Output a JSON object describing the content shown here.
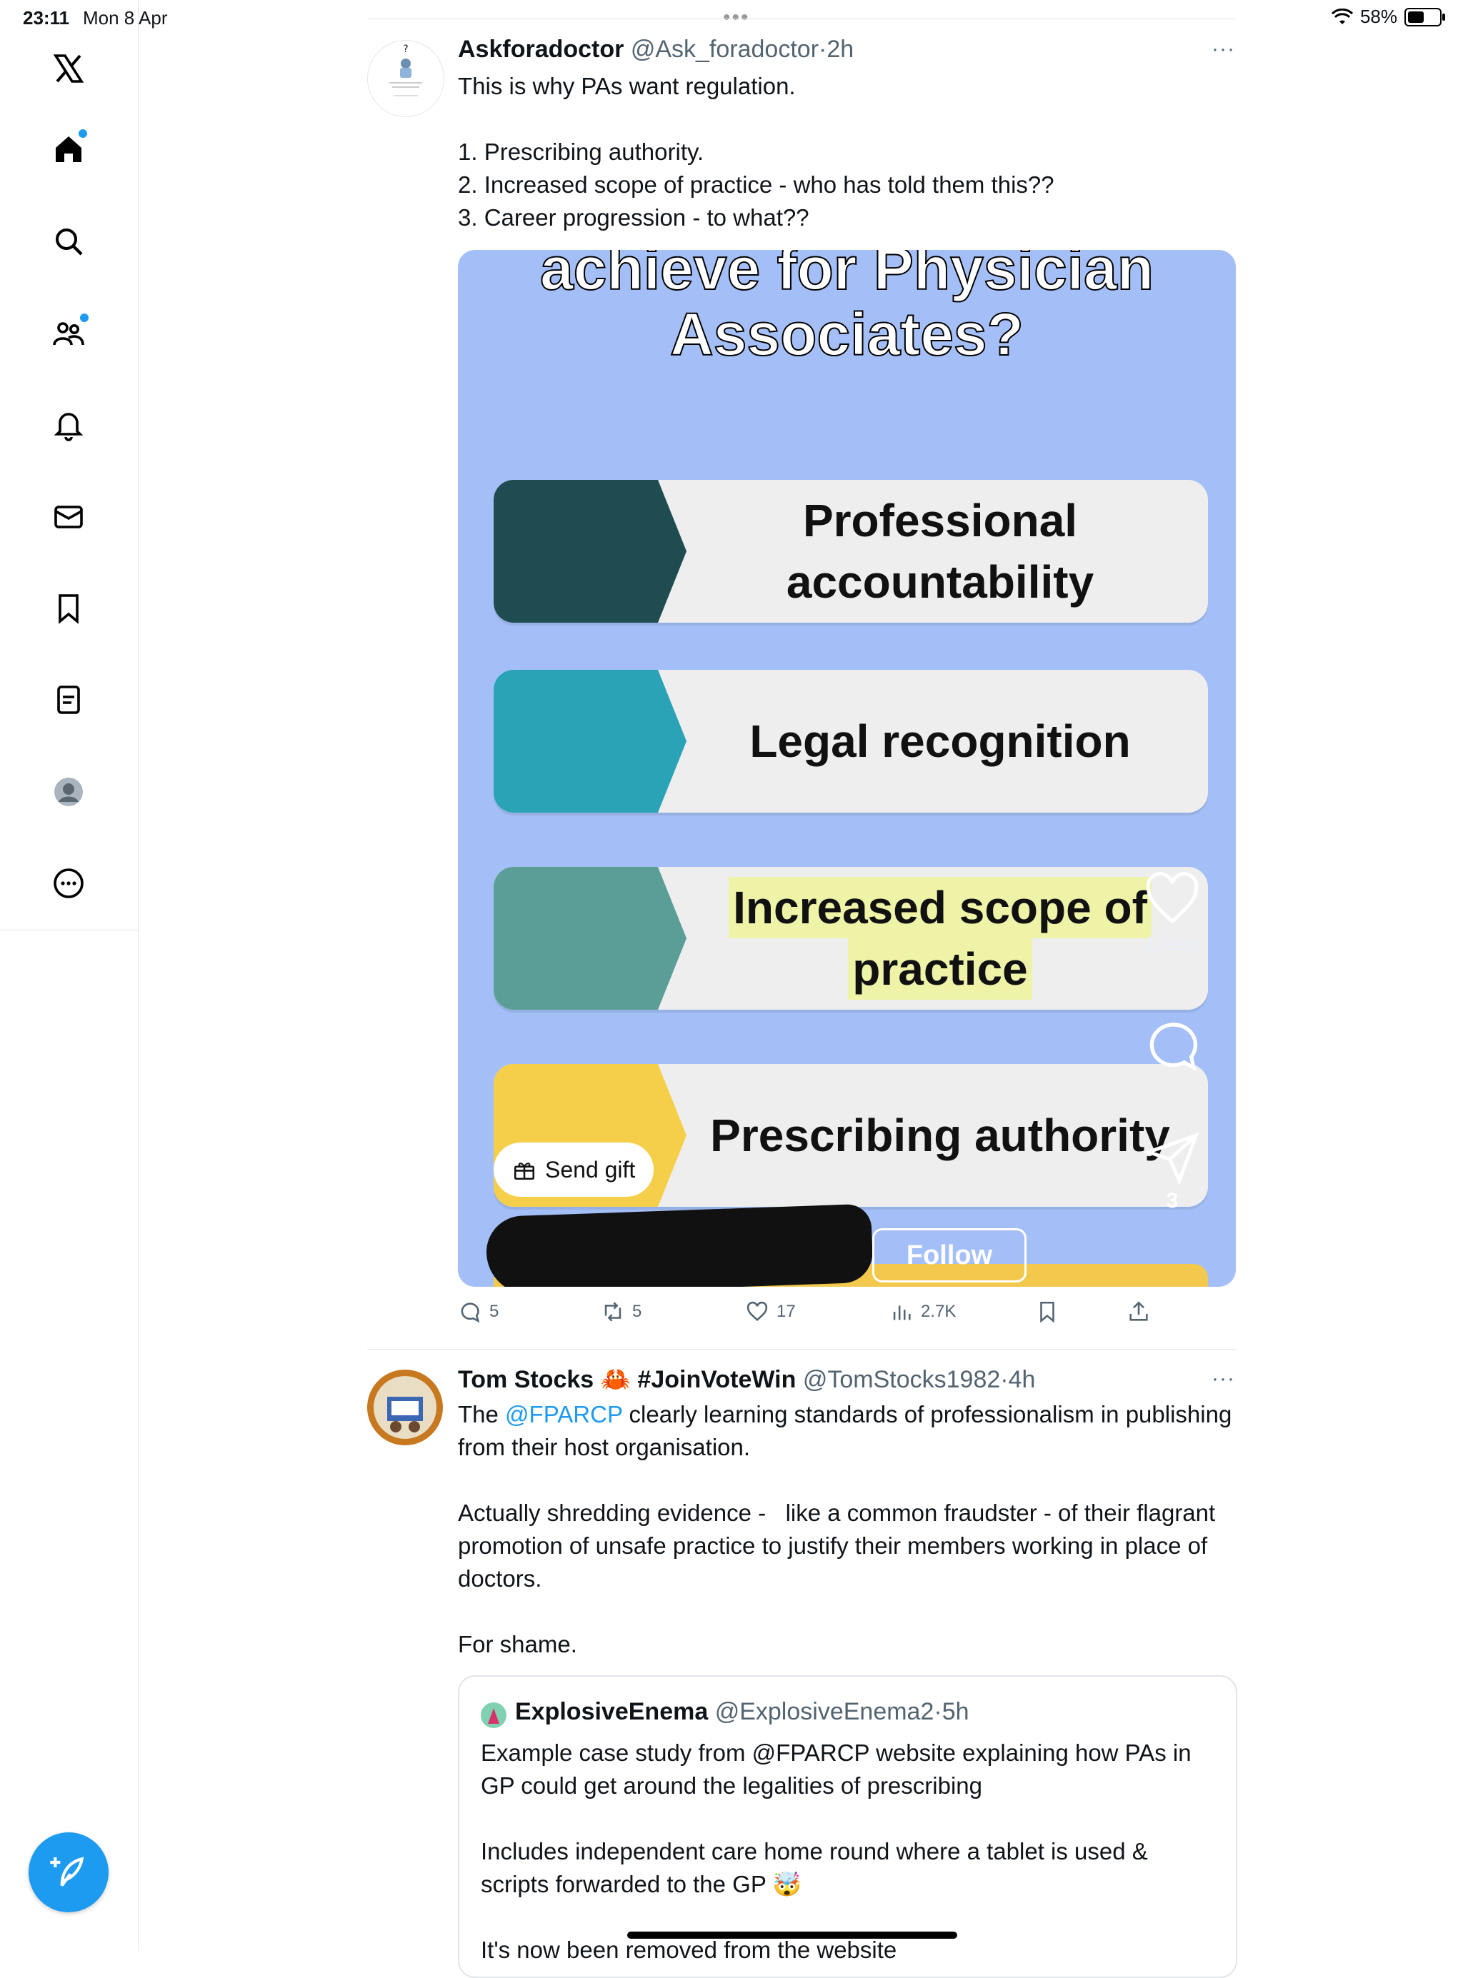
{
  "status_bar": {
    "time": "23:11",
    "date": "Mon 8 Apr",
    "battery": "58%",
    "battery_level": 0.58,
    "multitask_icon": "ellipsis-icon"
  },
  "sidebar": {
    "items": [
      {
        "name": "x-logo",
        "icon": "x-logo-icon"
      },
      {
        "name": "home",
        "icon": "home-icon",
        "badge": true
      },
      {
        "name": "search",
        "icon": "search-icon"
      },
      {
        "name": "communities",
        "icon": "people-icon",
        "badge": true
      },
      {
        "name": "notifications",
        "icon": "bell-icon"
      },
      {
        "name": "messages",
        "icon": "mail-icon"
      },
      {
        "name": "bookmarks",
        "icon": "bookmark-icon"
      },
      {
        "name": "lists",
        "icon": "list-icon"
      },
      {
        "name": "profile",
        "icon": "avatar-icon"
      },
      {
        "name": "more",
        "icon": "more-circle-icon"
      }
    ],
    "compose_icon": "feather-plus-icon"
  },
  "colors": {
    "accent": "#1d9bf0",
    "media_bg": "#a4bff7",
    "secondary_text": "#536471"
  },
  "tweet1": {
    "name": "Askforadoctor",
    "handle": "@Ask_foradoctor",
    "sep": "·",
    "time": "2h",
    "more": "···",
    "text": "This is why PAs want regulation.\n\n1. Prescribing authority.\n2. Increased scope of practice - who has told them this??\n3. Career progression - to what??",
    "media": {
      "header_top": "achieve for Physician",
      "header": "Associates?",
      "items": [
        {
          "label": "Professional accountability",
          "color": "#1f4c51"
        },
        {
          "label": "Legal recognition",
          "color": "#2aa3b6"
        },
        {
          "label_a": "Increased scope of",
          "label_b": "practice",
          "color": "#5b9e97"
        },
        {
          "label": "Prescribing authority",
          "color": "#f6cf4a"
        }
      ],
      "likes_label": "Likes",
      "share_count": "3",
      "send_gift": "Send gift",
      "follow": "Follow"
    },
    "actions": {
      "replies": "5",
      "reposts": "5",
      "likes": "17",
      "views": "2.7K"
    }
  },
  "tweet2": {
    "name": "Tom Stocks 🦀 #JoinVoteWin",
    "handle": "@TomStocks1982",
    "sep": "·",
    "time": "4h",
    "more": "···",
    "text_prefix": "The ",
    "mention": "@FPARCP",
    "text_rest": " clearly learning standards of professionalism in publishing from their host organisation.\n\nActually shredding evidence -   like a common fraudster - of their flagrant promotion of unsafe practice to justify their members working in place of doctors.\n\nFor shame.",
    "quote": {
      "name": "ExplosiveEnema",
      "handle": "@ExplosiveEnema2",
      "sep": "·",
      "time": "5h",
      "text": "Example case study from @FPARCP website explaining how PAs in GP could get around the legalities of prescribing\n\nIncludes independent care home round where a tablet is used & scripts forwarded to the GP 🤯\n\nIt's now been removed from the website"
    }
  }
}
